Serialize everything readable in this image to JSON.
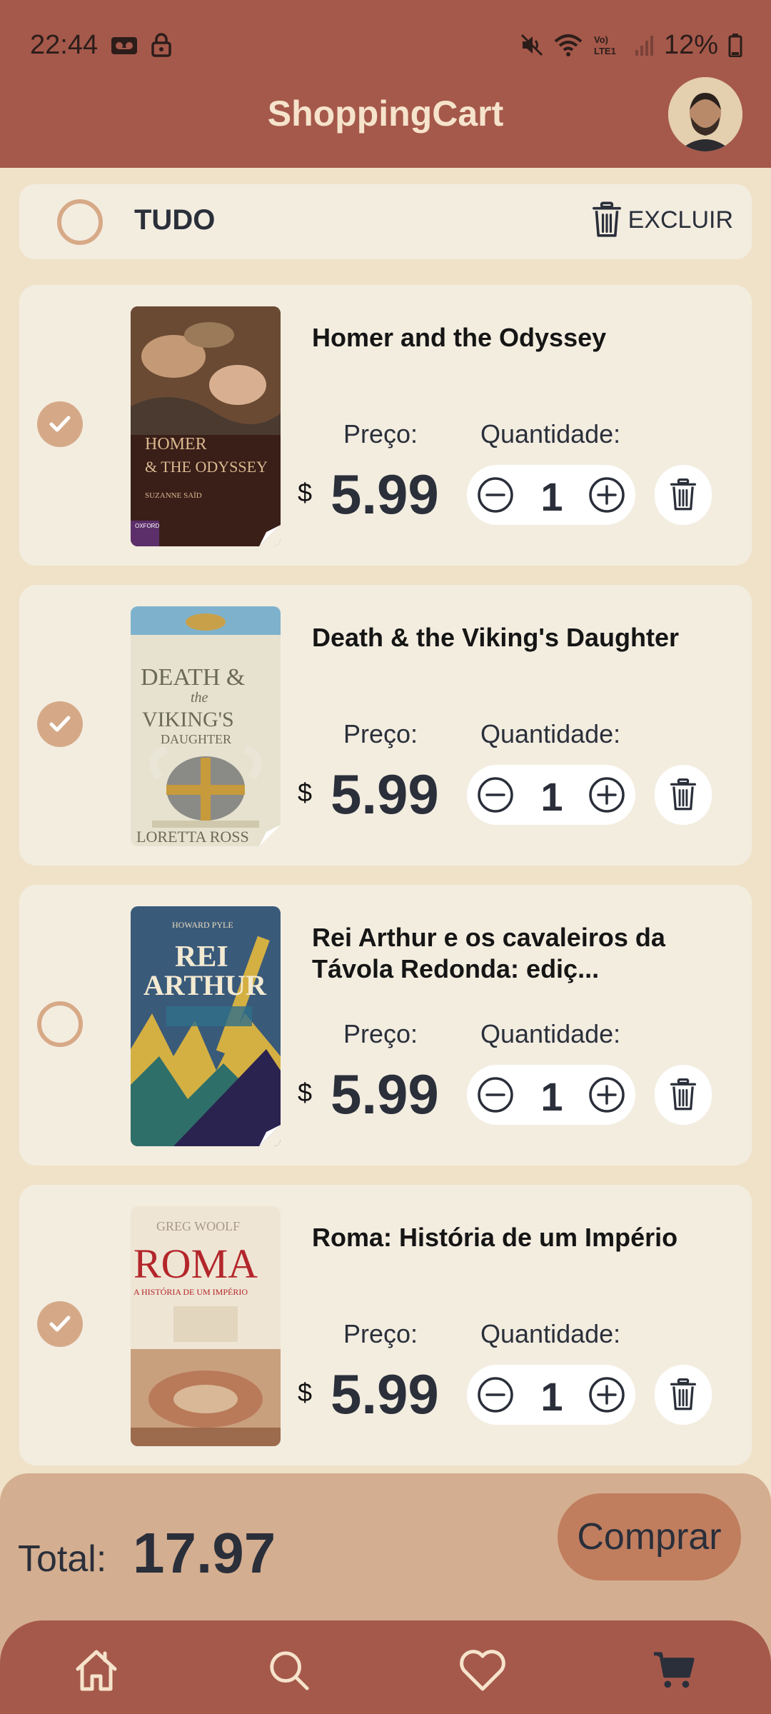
{
  "status_bar": {
    "time": "22:44",
    "battery_text": "12%",
    "lte_label_top": "Vo)",
    "lte_label_bottom": "LTE1"
  },
  "app": {
    "title": "ShoppingCart"
  },
  "select_all": {
    "label": "TUDO",
    "checked": false,
    "delete_label": "EXCLUIR"
  },
  "labels": {
    "price": "Preço:",
    "quantity": "Quantidade:",
    "currency": "$"
  },
  "items": [
    {
      "title": "Homer and the Odyssey",
      "price": "5.99",
      "quantity": "1",
      "checked": true,
      "cover": {
        "line1": "HOMER",
        "line2": "& THE ODYSSEY",
        "author": "SUZANNE SAÏD",
        "publisher": "OXFORD",
        "bg": "#3a1e18"
      }
    },
    {
      "title": "Death & the Viking's Daughter",
      "price": "5.99",
      "quantity": "1",
      "checked": true,
      "cover": {
        "line1": "DEATH &",
        "line2": "the",
        "line3": "VIKING'S",
        "line4": "DAUGHTER",
        "author": "LORETTA ROSS",
        "bg": "#e6e2cf"
      }
    },
    {
      "title": "Rei Arthur e os cavaleiros da Távola Redonda: ediç...",
      "price": "5.99",
      "quantity": "1",
      "checked": false,
      "cover": {
        "author": "HOWARD PYLE",
        "line1": "REI",
        "line2": "ARTHUR",
        "bg": "#3a5a7a"
      }
    },
    {
      "title": "Roma: História de um Império",
      "price": "5.99",
      "quantity": "1",
      "checked": true,
      "cover": {
        "author": "GREG WOOLF",
        "line1": "ROMA",
        "line2": "A HISTÓRIA DE UM IMPÉRIO",
        "bg": "#efe5d4"
      }
    }
  ],
  "total": {
    "label": "Total:",
    "value": "17.97",
    "buy_label": "Comprar"
  },
  "bottom_nav": [
    "home-icon",
    "search-icon",
    "heart-icon",
    "cart-icon"
  ],
  "colors": {
    "primary": "#a5594b",
    "background": "#f0e2c8",
    "card": "#f3ede0",
    "accent": "#d5a988",
    "buy_button": "#c07e5f",
    "total_bar": "#d4ae90",
    "title_text": "#f6e3cc"
  }
}
